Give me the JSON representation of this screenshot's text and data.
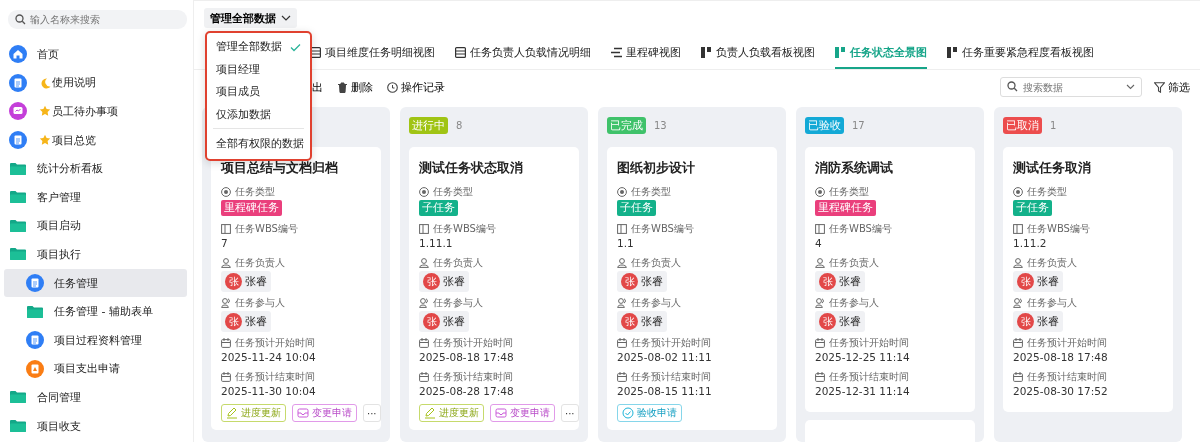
{
  "sidebar": {
    "search": {
      "placeholder": "输入名称来搜索"
    },
    "items": [
      {
        "label": "首页",
        "kind": "home",
        "selected": false
      },
      {
        "label": "使用说明",
        "kind": "doc_moon",
        "selected": false
      },
      {
        "label": "员工待办事项",
        "kind": "chat_star",
        "selected": false
      },
      {
        "label": "项目总览",
        "kind": "doc_star",
        "selected": false
      },
      {
        "label": "统计分析看板",
        "kind": "folder",
        "selected": false
      },
      {
        "label": "客户管理",
        "kind": "folder",
        "selected": false
      },
      {
        "label": "项目启动",
        "kind": "folder",
        "selected": false
      },
      {
        "label": "项目执行",
        "kind": "folder",
        "selected": false,
        "children": [
          {
            "label": "任务管理",
            "kind": "doc",
            "selected": true
          },
          {
            "label": "任务管理 - 辅助表单",
            "kind": "folder",
            "selected": false
          },
          {
            "label": "项目过程资料管理",
            "kind": "doc",
            "selected": false
          },
          {
            "label": "项目支出申请",
            "kind": "alert",
            "selected": false
          }
        ]
      },
      {
        "label": "合同管理",
        "kind": "folder",
        "selected": false
      },
      {
        "label": "项目收支",
        "kind": "folder",
        "selected": false
      }
    ]
  },
  "view_selector": {
    "label": "管理全部数据",
    "menu": [
      {
        "label": "管理全部数据",
        "selected": true
      },
      {
        "label": "项目经理",
        "selected": false
      },
      {
        "label": "项目成员",
        "selected": false
      },
      {
        "label": "仅添加数据",
        "selected": false
      },
      {
        "kind": "divider"
      },
      {
        "label": "全部有权限的数据",
        "selected": false
      }
    ]
  },
  "tabs": [
    {
      "label": "项目维度任务明细视图",
      "kind": "table",
      "selected": false
    },
    {
      "label": "任务负责人负载情况明细",
      "kind": "table",
      "selected": false
    },
    {
      "label": "里程碑视图",
      "kind": "milestone",
      "selected": false
    },
    {
      "label": "负责人负载看板视图",
      "kind": "kanban",
      "selected": false
    },
    {
      "label": "任务状态全景图",
      "kind": "kanban",
      "selected": true
    },
    {
      "label": "任务重要紧急程度看板视图",
      "kind": "kanban",
      "selected": false
    }
  ],
  "toolbar": {
    "actions": [
      {
        "label": "出",
        "kind": "none"
      },
      {
        "label": "删除",
        "kind": "trash"
      },
      {
        "label": "操作记录",
        "kind": "clock"
      }
    ],
    "search": {
      "placeholder": "搜索数据"
    },
    "filter": "筛选"
  },
  "columns": [
    {
      "cards": [
        {
          "title": "项目总结与文档归档",
          "fields": [
            {
              "kind": "type",
              "label": "任务类型",
              "tag": {
                "label": "里程碑任务",
                "color": "#ea3f7c"
              }
            },
            {
              "kind": "wbs",
              "label": "任务WBS编号",
              "value": "7"
            },
            {
              "kind": "owner",
              "label": "任务负责人",
              "person": {
                "avatar": "张",
                "name": "张睿"
              }
            },
            {
              "kind": "participant",
              "label": "任务参与人",
              "person": {
                "avatar": "张",
                "name": "张睿"
              }
            },
            {
              "kind": "start",
              "label": "任务预计开始时间",
              "value": "2025-11-24 10:04"
            },
            {
              "kind": "end",
              "label": "任务预计结束时间",
              "value": "2025-11-30 10:04"
            }
          ],
          "actions": [
            {
              "label": "进度更新",
              "kind": "edit"
            },
            {
              "label": "变更申请",
              "kind": "change"
            },
            {
              "label": "···",
              "kind": "more"
            }
          ]
        }
      ]
    },
    {
      "status": {
        "label": "进行中",
        "color": "#a0c414"
      },
      "count": "8",
      "cards": [
        {
          "title": "测试任务状态取消",
          "fields": [
            {
              "kind": "type",
              "label": "任务类型",
              "tag": {
                "label": "子任务",
                "color": "#13b18a"
              }
            },
            {
              "kind": "wbs",
              "label": "任务WBS编号",
              "value": "1.11.1"
            },
            {
              "kind": "owner",
              "label": "任务负责人",
              "person": {
                "avatar": "张",
                "name": "张睿"
              }
            },
            {
              "kind": "participant",
              "label": "任务参与人",
              "person": {
                "avatar": "张",
                "name": "张睿"
              }
            },
            {
              "kind": "start",
              "label": "任务预计开始时间",
              "value": "2025-08-18 17:48"
            },
            {
              "kind": "end",
              "label": "任务预计结束时间",
              "value": "2025-08-28 17:48"
            }
          ],
          "actions": [
            {
              "label": "进度更新",
              "kind": "edit"
            },
            {
              "label": "变更申请",
              "kind": "change"
            },
            {
              "label": "···",
              "kind": "more"
            }
          ]
        }
      ]
    },
    {
      "status": {
        "label": "已完成",
        "color": "#3fc26a"
      },
      "count": "13",
      "cards": [
        {
          "title": "图纸初步设计",
          "fields": [
            {
              "kind": "type",
              "label": "任务类型",
              "tag": {
                "label": "子任务",
                "color": "#13b18a"
              }
            },
            {
              "kind": "wbs",
              "label": "任务WBS编号",
              "value": "1.1"
            },
            {
              "kind": "owner",
              "label": "任务负责人",
              "person": {
                "avatar": "张",
                "name": "张睿"
              }
            },
            {
              "kind": "participant",
              "label": "任务参与人",
              "person": {
                "avatar": "张",
                "name": "张睿"
              }
            },
            {
              "kind": "start",
              "label": "任务预计开始时间",
              "value": "2025-08-02 11:11"
            },
            {
              "kind": "end",
              "label": "任务预计结束时间",
              "value": "2025-08-15 11:11"
            }
          ],
          "actions": [
            {
              "label": "验收申请",
              "kind": "accept"
            }
          ]
        }
      ]
    },
    {
      "status": {
        "label": "已验收",
        "color": "#13a9d6"
      },
      "count": "17",
      "cards": [
        {
          "title": "消防系统调试",
          "fields": [
            {
              "kind": "type",
              "label": "任务类型",
              "tag": {
                "label": "里程碑任务",
                "color": "#ea3f7c"
              }
            },
            {
              "kind": "wbs",
              "label": "任务WBS编号",
              "value": "4"
            },
            {
              "kind": "owner",
              "label": "任务负责人",
              "person": {
                "avatar": "张",
                "name": "张睿"
              }
            },
            {
              "kind": "participant",
              "label": "任务参与人",
              "person": {
                "avatar": "张",
                "name": "张睿"
              }
            },
            {
              "kind": "start",
              "label": "任务预计开始时间",
              "value": "2025-12-25 11:14"
            },
            {
              "kind": "end",
              "label": "任务预计结束时间",
              "value": "2025-12-31 11:14"
            }
          ]
        },
        {
          "kind": "stub"
        }
      ]
    },
    {
      "status": {
        "label": "已取消",
        "color": "#ec4d4d"
      },
      "count": "1",
      "cards": [
        {
          "title": "测试任务取消",
          "fields": [
            {
              "kind": "type",
              "label": "任务类型",
              "tag": {
                "label": "子任务",
                "color": "#13b18a"
              }
            },
            {
              "kind": "wbs",
              "label": "任务WBS编号",
              "value": "1.11.2"
            },
            {
              "kind": "owner",
              "label": "任务负责人",
              "person": {
                "avatar": "张",
                "name": "张睿"
              }
            },
            {
              "kind": "participant",
              "label": "任务参与人",
              "person": {
                "avatar": "张",
                "name": "张睿"
              }
            },
            {
              "kind": "start",
              "label": "任务预计开始时间",
              "value": "2025-08-18 17:48"
            },
            {
              "kind": "end",
              "label": "任务预计结束时间",
              "value": "2025-08-30 17:52"
            }
          ]
        }
      ]
    }
  ]
}
